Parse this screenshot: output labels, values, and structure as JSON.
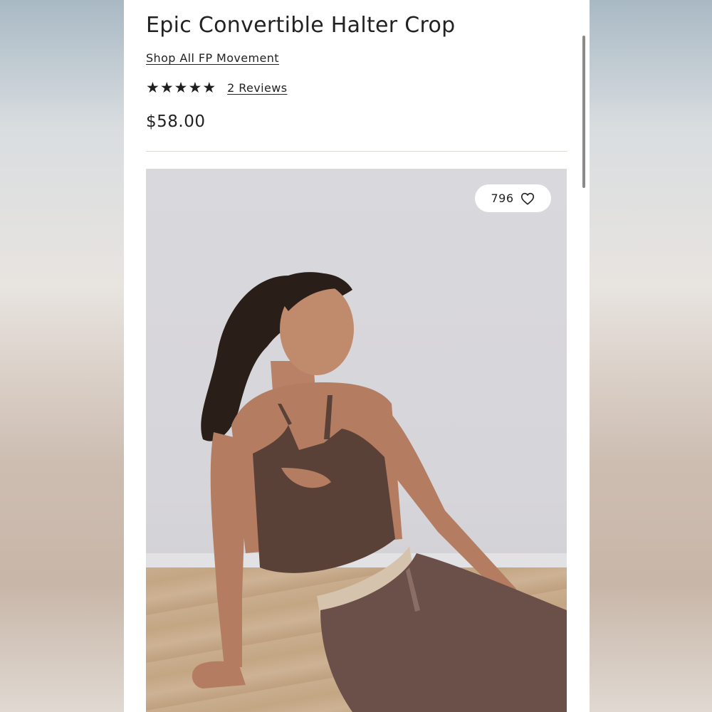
{
  "product": {
    "title": "Epic Convertible Halter Crop",
    "shop_link": "Shop All FP Movement",
    "rating_stars": 5,
    "reviews_label": "2 Reviews",
    "price": "$58.00"
  },
  "image": {
    "favorites_count": "796",
    "favorite_icon": "heart-outline-icon"
  },
  "colors": {
    "text": "#222222",
    "page_bg": "#ffffff",
    "divider": "#dcd8d2",
    "top_color": "#5a4137",
    "pants_color": "#6a5048"
  }
}
